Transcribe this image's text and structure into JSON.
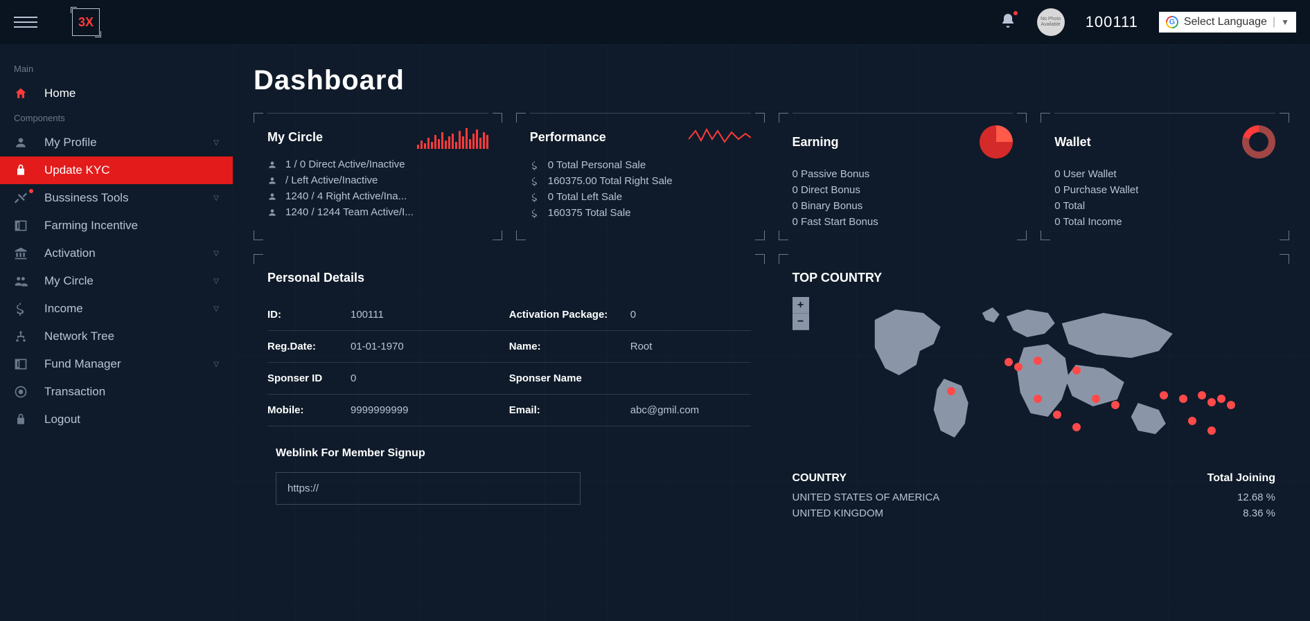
{
  "header": {
    "logo": "3X",
    "userId": "100111",
    "avatarText": "No Photo Available",
    "langLabel": "Select Language"
  },
  "sidebar": {
    "section1": "Main",
    "section2": "Components",
    "home": "Home",
    "items": [
      {
        "label": "My Profile",
        "chevron": true
      },
      {
        "label": "Update KYC",
        "active": true
      },
      {
        "label": "Bussiness Tools",
        "chevron": true,
        "dot": true
      },
      {
        "label": "Farming Incentive"
      },
      {
        "label": "Activation",
        "chevron": true
      },
      {
        "label": "My Circle",
        "chevron": true
      },
      {
        "label": "Income",
        "chevron": true
      },
      {
        "label": "Network Tree"
      },
      {
        "label": "Fund Manager",
        "chevron": true
      },
      {
        "label": "Transaction"
      },
      {
        "label": "Logout"
      }
    ]
  },
  "page": {
    "title": "Dashboard"
  },
  "cards": {
    "circle": {
      "title": "My Circle",
      "items": [
        "1 / 0 Direct Active/Inactive",
        "/ Left Active/Inactive",
        "1240 / 4 Right Active/Ina...",
        "1240 / 1244 Team Active/I..."
      ]
    },
    "performance": {
      "title": "Performance",
      "items": [
        "0 Total Personal Sale",
        "160375.00 Total Right Sale",
        "0 Total Left Sale",
        "160375 Total Sale"
      ]
    },
    "earning": {
      "title": "Earning",
      "items": [
        "0 Passive Bonus",
        "0 Direct Bonus",
        "0 Binary Bonus",
        "0 Fast Start Bonus"
      ]
    },
    "wallet": {
      "title": "Wallet",
      "items": [
        "0 User Wallet",
        "0 Purchase Wallet",
        "0 Total",
        "0 Total Income"
      ]
    }
  },
  "personal": {
    "title": "Personal Details",
    "id_label": "ID:",
    "id": "100111",
    "pkg_label": "Activation Package:",
    "pkg": "0",
    "reg_label": "Reg.Date:",
    "reg": "01-01-1970",
    "name_label": "Name:",
    "name": "Root",
    "spid_label": "Sponser ID",
    "spid": "0",
    "spname_label": "Sponser Name",
    "spname": "",
    "mobile_label": "Mobile:",
    "mobile": "9999999999",
    "email_label": "Email:",
    "email": "abc@gmil.com",
    "weblink_title": "Weblink For Member Signup",
    "weblink": "https://"
  },
  "topCountry": {
    "title": "TOP COUNTRY",
    "zoomIn": "+",
    "zoomOut": "−",
    "headers": {
      "country": "COUNTRY",
      "joining": "Total Joining"
    },
    "rows": [
      {
        "country": "UNITED STATES OF AMERICA",
        "pct": "12.68 %"
      },
      {
        "country": "UNITED KINGDOM",
        "pct": "8.36 %"
      }
    ]
  },
  "sparkBars": [
    6,
    12,
    8,
    16,
    10,
    20,
    14,
    24,
    12,
    18,
    22,
    10,
    26,
    18,
    30,
    14,
    22,
    28,
    16,
    24,
    20
  ],
  "markers": [
    {
      "x": 44,
      "y": 37
    },
    {
      "x": 46,
      "y": 40
    },
    {
      "x": 50,
      "y": 36
    },
    {
      "x": 58,
      "y": 42
    },
    {
      "x": 32,
      "y": 55
    },
    {
      "x": 50,
      "y": 60
    },
    {
      "x": 54,
      "y": 70
    },
    {
      "x": 58,
      "y": 78
    },
    {
      "x": 62,
      "y": 60
    },
    {
      "x": 66,
      "y": 64
    },
    {
      "x": 76,
      "y": 58
    },
    {
      "x": 80,
      "y": 60
    },
    {
      "x": 84,
      "y": 58
    },
    {
      "x": 86,
      "y": 62
    },
    {
      "x": 88,
      "y": 60
    },
    {
      "x": 90,
      "y": 64
    },
    {
      "x": 82,
      "y": 74
    },
    {
      "x": 86,
      "y": 80
    }
  ]
}
